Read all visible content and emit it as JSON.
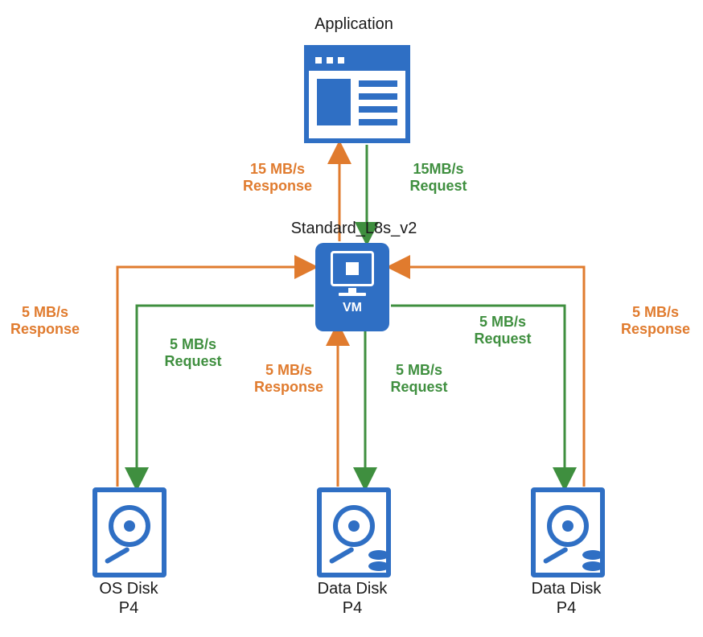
{
  "colors": {
    "blue": "#2f6fc4",
    "green": "#3f8f3f",
    "orange": "#e07b2e"
  },
  "nodes": {
    "application": {
      "label": "Application"
    },
    "vm": {
      "title": "Standard_L8s_v2",
      "badge": "VM"
    },
    "disks": [
      {
        "name_line1": "OS Disk",
        "name_line2": "P4"
      },
      {
        "name_line1": "Data Disk",
        "name_line2": "P4"
      },
      {
        "name_line1": "Data Disk",
        "name_line2": "P4"
      }
    ]
  },
  "flows": {
    "app_vm": {
      "response": {
        "line1": "15 MB/s",
        "line2": "Response"
      },
      "request": {
        "line1": "15MB/s",
        "line2": "Request"
      }
    },
    "os_disk": {
      "request": {
        "line1": "5 MB/s",
        "line2": "Request"
      },
      "response": {
        "line1": "5 MB/s",
        "line2": "Response"
      }
    },
    "data_disk1": {
      "request": {
        "line1": "5 MB/s",
        "line2": "Request"
      },
      "response": {
        "line1": "5 MB/s",
        "line2": "Response"
      }
    },
    "data_disk2": {
      "request": {
        "line1": "5 MB/s",
        "line2": "Request"
      },
      "response": {
        "line1": "5 MB/s",
        "line2": "Response"
      }
    }
  }
}
